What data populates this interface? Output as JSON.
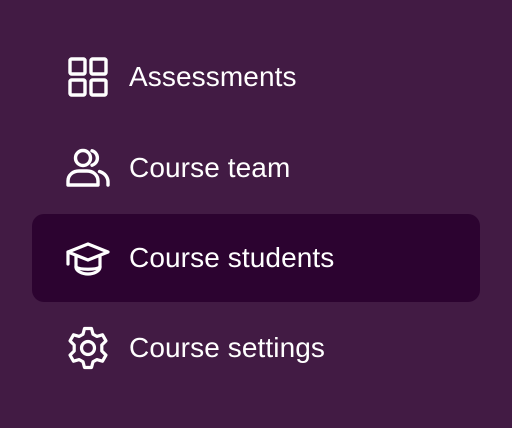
{
  "sidebar": {
    "items": [
      {
        "label": "Assessments",
        "icon": "grid-icon",
        "active": false
      },
      {
        "label": "Course team",
        "icon": "users-icon",
        "active": false
      },
      {
        "label": "Course students",
        "icon": "graduation-cap-icon",
        "active": true
      },
      {
        "label": "Course settings",
        "icon": "gear-icon",
        "active": false
      }
    ]
  },
  "colors": {
    "background": "#421B44",
    "active_background": "#2C0330",
    "text": "#FFFFFF"
  }
}
